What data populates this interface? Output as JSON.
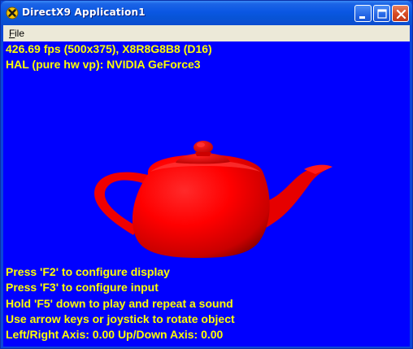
{
  "window": {
    "title": "DirectX9 Application1",
    "icon": "directx-x-icon",
    "buttons": {
      "minimize": "minimize-icon",
      "maximize": "maximize-icon",
      "close": "close-icon"
    }
  },
  "menu": {
    "file_label_accel": "F",
    "file_label_rest": "ile"
  },
  "scene": {
    "background_color": "#0000ff",
    "text_color": "#ffff00",
    "object": "teapot",
    "object_color": "#ff0000",
    "frame_stats": "426.69 fps (500x375), X8R8G8B8 (D16)",
    "device_stats": "HAL (pure hw vp): NVIDIA GeForce3",
    "help_lines": [
      "Press 'F2' to configure display",
      "Press 'F3' to configure input",
      "Hold 'F5' down to play and repeat a sound",
      "Use arrow keys or joystick to rotate object",
      "Left/Right Axis: 0.00 Up/Down Axis: 0.00"
    ]
  }
}
